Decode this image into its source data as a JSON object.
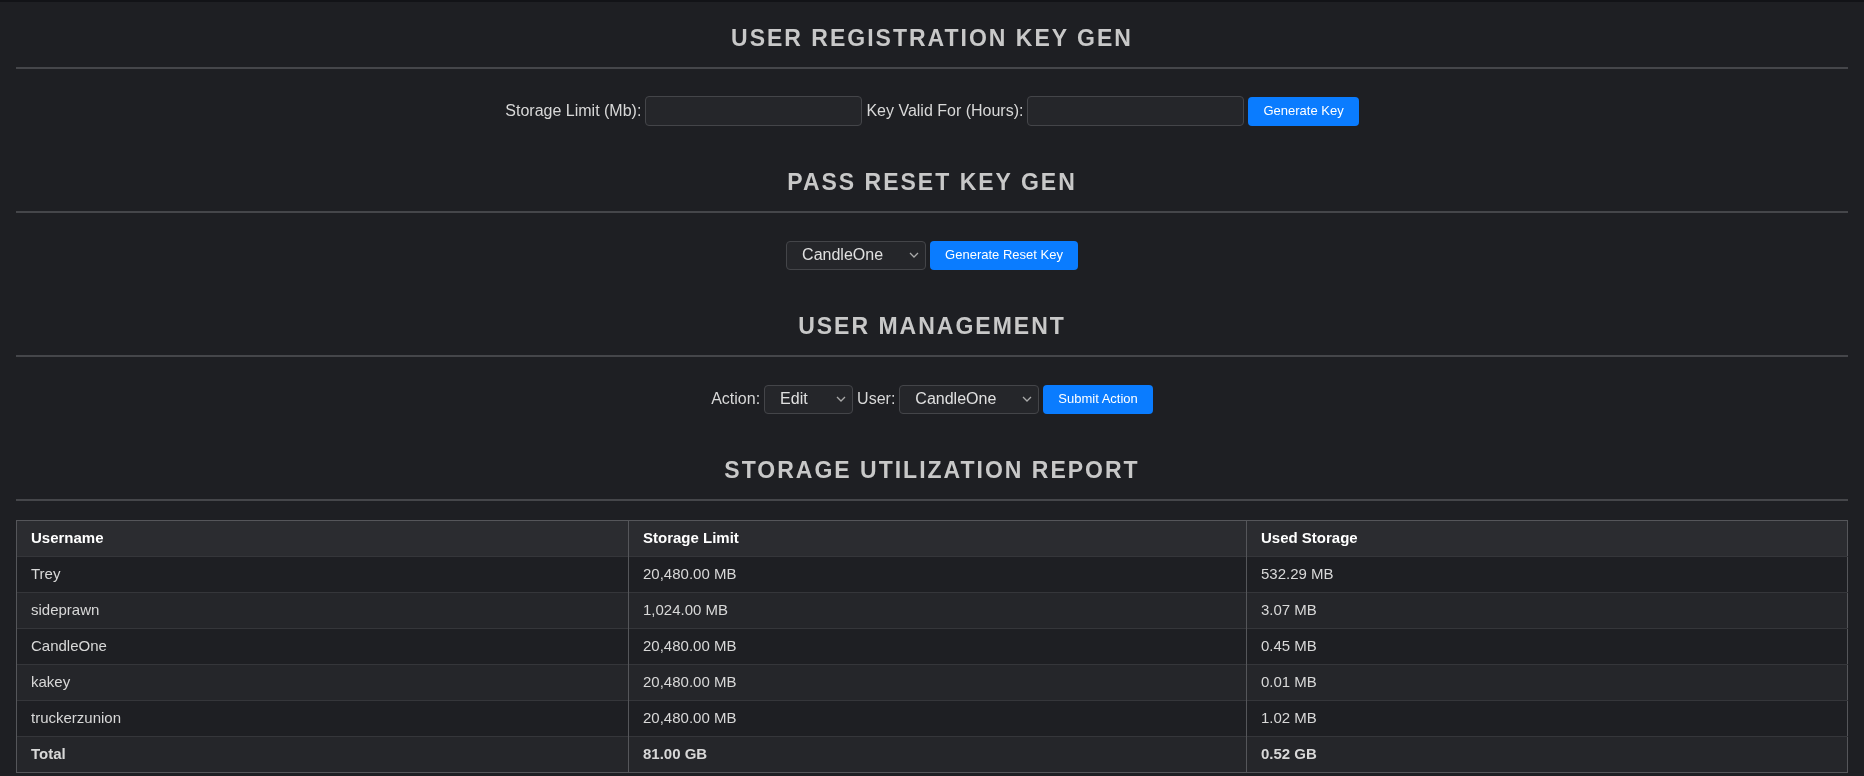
{
  "registration": {
    "title": "USER REGISTRATION KEY GEN",
    "storage_label": "Storage Limit (Mb):",
    "valid_label": "Key Valid For (Hours):",
    "button": "Generate Key"
  },
  "reset": {
    "title": "PASS RESET KEY GEN",
    "user": "CandleOne",
    "button": "Generate Reset Key"
  },
  "management": {
    "title": "USER MANAGEMENT",
    "action_label": "Action:",
    "action": "Edit",
    "user_label": "User:",
    "user": "CandleOne",
    "button": "Submit Action"
  },
  "report": {
    "title": "STORAGE UTILIZATION REPORT",
    "columns": [
      "Username",
      "Storage Limit",
      "Used Storage"
    ],
    "rows": [
      {
        "kind": "user",
        "cells": [
          "Trey",
          "20,480.00 MB",
          "532.29 MB"
        ]
      },
      {
        "kind": "user",
        "cells": [
          "sideprawn",
          "1,024.00 MB",
          "3.07 MB"
        ]
      },
      {
        "kind": "user",
        "cells": [
          "CandleOne",
          "20,480.00 MB",
          "0.45 MB"
        ]
      },
      {
        "kind": "user",
        "cells": [
          "kakey",
          "20,480.00 MB",
          "0.01 MB"
        ]
      },
      {
        "kind": "user",
        "cells": [
          "truckerzunion",
          "20,480.00 MB",
          "1.02 MB"
        ]
      },
      {
        "kind": "total",
        "cells": [
          "Total",
          "81.00 GB",
          "0.52 GB"
        ]
      }
    ]
  }
}
